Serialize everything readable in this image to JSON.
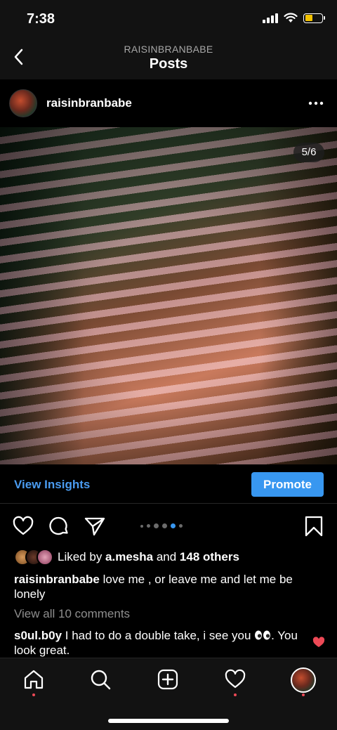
{
  "status_bar": {
    "time": "7:38"
  },
  "header": {
    "subtitle": "RAISINBRANBABE",
    "title": "Posts"
  },
  "post": {
    "username": "raisinbranbabe",
    "photo_counter": "5/6",
    "insights_label": "View Insights",
    "promote_label": "Promote",
    "carousel": {
      "total": 6,
      "active_index": 4
    },
    "likes": {
      "prefix": "Liked by ",
      "user": "a.mesha",
      "middle": " and ",
      "others": "148 others"
    },
    "caption": {
      "user": "raisinbranbabe",
      "text": " love me , or leave me and let me be lonely"
    },
    "view_comments": "View all 10 comments",
    "comment": {
      "user": "s0ul.b0y",
      "text_before": " I had to do a double take, i see you ",
      "text_after": ". You look great."
    }
  },
  "colors": {
    "accent": "#3897f0",
    "notification": "#ed4956",
    "muted": "#8e8e8e"
  },
  "icons": [
    "back-icon",
    "more-icon",
    "heart-icon",
    "comment-icon",
    "share-icon",
    "bookmark-icon",
    "eyes-emoji-icon",
    "home-icon",
    "search-icon",
    "create-icon",
    "activity-icon"
  ]
}
